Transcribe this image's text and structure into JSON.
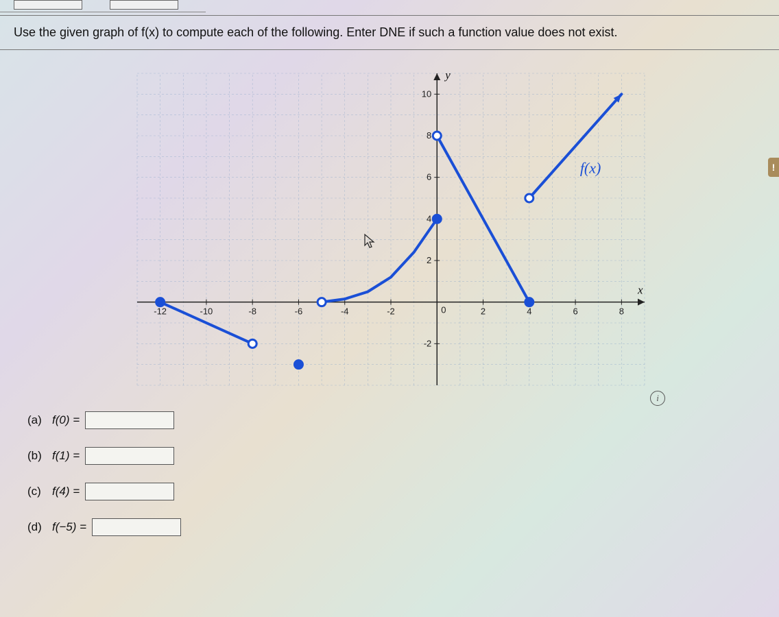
{
  "question": "Use the given graph of f(x) to compute each of the following. Enter DNE if such a function value does not exist.",
  "info_icon": "i",
  "side_tab": "!",
  "answers": {
    "a": {
      "label": "(a)",
      "fn": "f(0) =",
      "value": ""
    },
    "b": {
      "label": "(b)",
      "fn": "f(1) =",
      "value": ""
    },
    "c": {
      "label": "(c)",
      "fn": "f(4) =",
      "value": ""
    },
    "d": {
      "label": "(d)",
      "fn": "f(−5) =",
      "value": ""
    }
  },
  "chart_data": {
    "type": "line",
    "title": "",
    "xlabel": "x",
    "ylabel": "y",
    "function_label": "f(x)",
    "xlim": [
      -13,
      9
    ],
    "ylim": [
      -4,
      11
    ],
    "x_ticks": [
      -12,
      -10,
      -8,
      -6,
      -4,
      -2,
      0,
      2,
      4,
      6,
      8
    ],
    "y_ticks": [
      -2,
      0,
      2,
      4,
      6,
      8,
      10
    ],
    "segments": [
      {
        "kind": "line",
        "points": [
          [
            -12,
            0
          ],
          [
            -8,
            -2
          ]
        ],
        "start": "closed",
        "end": "open"
      },
      {
        "kind": "point",
        "points": [
          [
            -6,
            -3
          ]
        ],
        "style": "isolated-closed"
      },
      {
        "kind": "curve",
        "points": [
          [
            -5,
            0
          ],
          [
            -4,
            0.15
          ],
          [
            -3,
            0.5
          ],
          [
            -2,
            1.2
          ],
          [
            -1,
            2.4
          ],
          [
            0,
            4
          ]
        ],
        "start": "open",
        "end": "closed"
      },
      {
        "kind": "line",
        "points": [
          [
            0,
            8
          ],
          [
            4,
            0
          ]
        ],
        "start": "open",
        "end": "closed"
      },
      {
        "kind": "line",
        "points": [
          [
            4,
            5
          ],
          [
            8,
            10
          ]
        ],
        "start": "open",
        "end": "arrow"
      }
    ]
  }
}
